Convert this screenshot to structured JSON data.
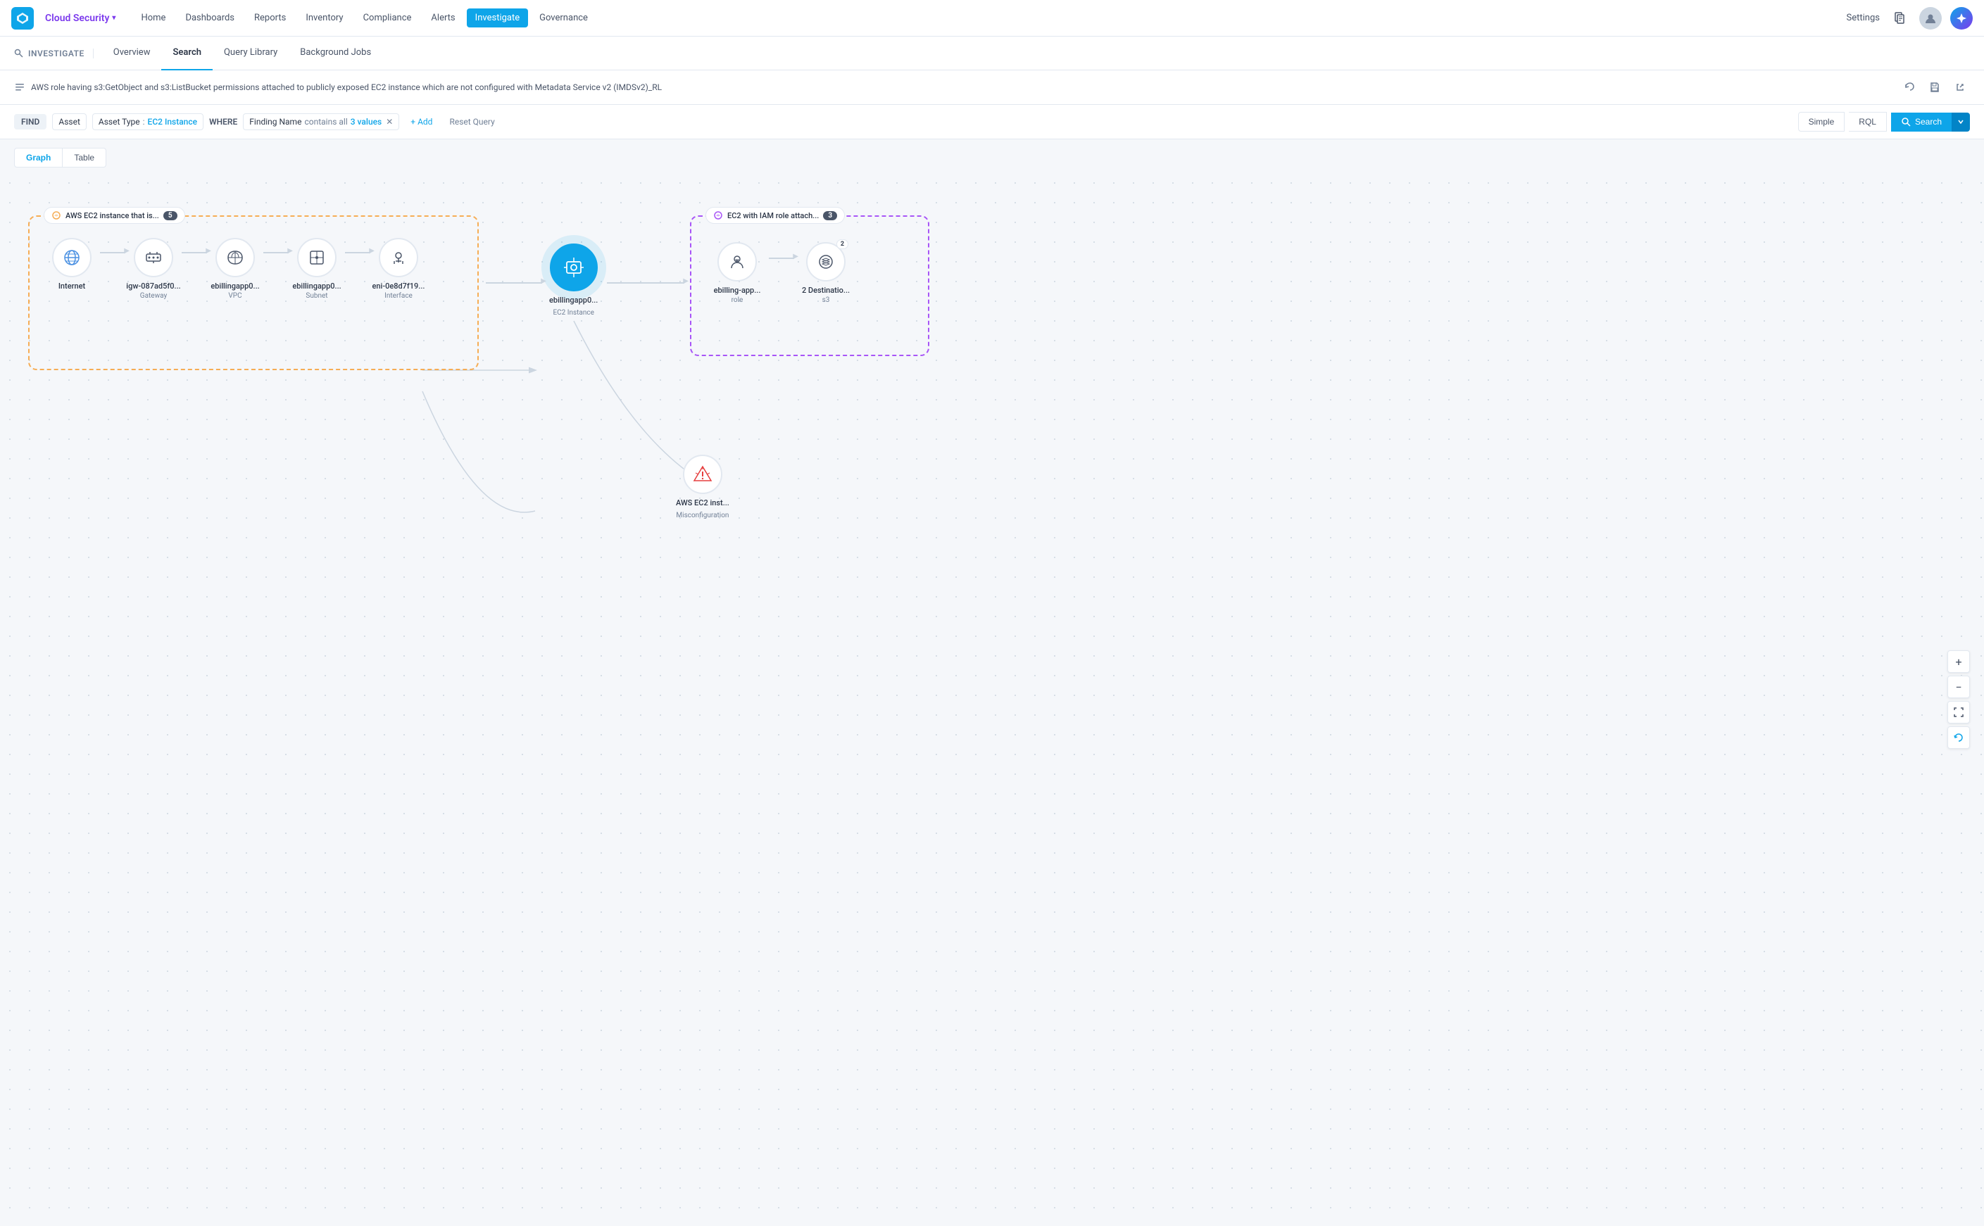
{
  "app": {
    "logo": "◈",
    "brand": "Cloud Security",
    "brand_chevron": "▾"
  },
  "top_nav": {
    "items": [
      {
        "label": "Home",
        "active": false
      },
      {
        "label": "Dashboards",
        "active": false
      },
      {
        "label": "Reports",
        "active": false
      },
      {
        "label": "Inventory",
        "active": false
      },
      {
        "label": "Compliance",
        "active": false
      },
      {
        "label": "Alerts",
        "active": false
      },
      {
        "label": "Investigate",
        "active": true
      },
      {
        "label": "Governance",
        "active": false
      }
    ],
    "settings_label": "Settings"
  },
  "sub_nav": {
    "section_label": "INVESTIGATE",
    "items": [
      {
        "label": "Overview",
        "active": false
      },
      {
        "label": "Search",
        "active": true
      },
      {
        "label": "Query Library",
        "active": false
      },
      {
        "label": "Background Jobs",
        "active": false
      }
    ]
  },
  "query_bar": {
    "text": "AWS role having s3:GetObject and s3:ListBucket permissions attached to publicly exposed EC2 instance which are not configured with Metadata Service v2 (IMDSv2)_RL",
    "icon": "≡"
  },
  "filter_row": {
    "find_label": "FIND",
    "asset_label": "Asset",
    "asset_type_label": "Asset Type",
    "asset_type_colon": ":",
    "asset_type_value": "EC2 Instance",
    "where_label": "WHERE",
    "filter_field": "Finding Name",
    "filter_op": "contains all",
    "filter_value": "3 values",
    "add_label": "+ Add",
    "reset_label": "Reset Query",
    "simple_label": "Simple",
    "rql_label": "RQL",
    "search_label": "Search"
  },
  "view_toggle": {
    "graph_label": "Graph",
    "table_label": "Table"
  },
  "graph": {
    "cluster1": {
      "label": "AWS EC2 instance that is...",
      "count": "5",
      "color": "#f6ad55",
      "border_color": "#f6ad55"
    },
    "cluster2": {
      "label": "EC2 with IAM role attach...",
      "count": "3",
      "color": "#a855f7",
      "border_color": "#a855f7"
    },
    "nodes_cluster1": [
      {
        "icon": "🌐",
        "label": "Internet",
        "sublabel": "",
        "highlighted": false
      },
      {
        "icon": "⊞",
        "label": "igw-087ad5f0...",
        "sublabel": "Gateway",
        "highlighted": false
      },
      {
        "icon": "☁",
        "label": "ebillingapp0...",
        "sublabel": "VPC",
        "highlighted": false
      },
      {
        "icon": "⊟",
        "label": "ebillingapp0...",
        "sublabel": "Subnet",
        "highlighted": false
      },
      {
        "icon": "⊡",
        "label": "eni-0e8d7f19...",
        "sublabel": "Interface",
        "highlighted": false
      }
    ],
    "node_central": {
      "icon": "⚙",
      "label": "ebillingapp0...",
      "sublabel": "EC2 Instance",
      "highlighted": true
    },
    "nodes_cluster2": [
      {
        "icon": "🛡",
        "label": "ebilling-app...",
        "sublabel": "role",
        "highlighted": false
      },
      {
        "icon": "⊕",
        "label": "2 Destinatio...",
        "sublabel": "s3",
        "highlighted": false,
        "badge": "2"
      }
    ],
    "node_misc": {
      "icon": "≡",
      "label": "AWS EC2 inst...",
      "sublabel": "Misconfiguration",
      "highlighted": false,
      "color": "#e53e3e"
    }
  },
  "zoom_controls": {
    "plus": "+",
    "minus": "−",
    "fit": "⛶",
    "reset": "↺"
  }
}
